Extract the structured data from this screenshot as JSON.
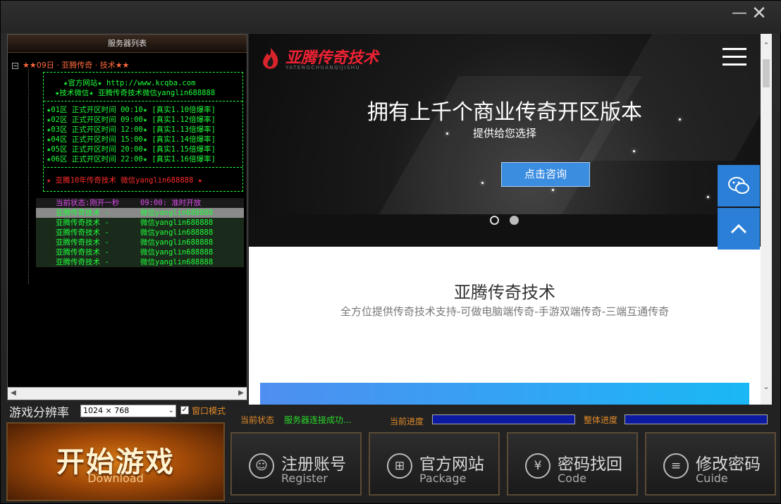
{
  "window": {
    "minimize_icon": "minimize-icon",
    "close_icon": "close-icon",
    "min_glyph": "—",
    "close_glyph": "✕"
  },
  "server_list": {
    "header": "服务器列表",
    "root": "★★09日 · 亚腾传奇 · 技术★★",
    "info": {
      "site": "★官方网站★ http://www.kcqba.com",
      "wechat": "★技术微信★ 亚腾传奇技术微信yanglin688888",
      "zones": [
        "★01区 正式开区时间  00:10★ [真实1.10倍爆率]",
        "★02区 正式开区时间  09:00★ [真实1.12倍爆率]",
        "★03区 正式开区时间  12:00★ [真实1.13倍爆率]",
        "★04区 正式开区时间  15:00★ [真实1.14倍爆率]",
        "★05区 正式开区时间  20:00★ [真实1.15倍爆率]",
        "★06区 正式开区时间  22:00★ [真实1.16倍爆率]"
      ],
      "footer": "★   亚腾10年传奇技术 微信yanglin688888   ★"
    },
    "status_header": {
      "col1": "当前状态:刚开一秒",
      "col2": "09:00: 准时开放"
    },
    "servers": [
      {
        "name": "亚腾传奇技术 -",
        "contact": "微信yanglin688888"
      },
      {
        "name": "亚腾传奇技术 -",
        "contact": "微信yanglin688888"
      },
      {
        "name": "亚腾传奇技术 -",
        "contact": "微信yanglin688888"
      },
      {
        "name": "亚腾传奇技术 -",
        "contact": "微信yanglin688888"
      },
      {
        "name": "亚腾传奇技术 -",
        "contact": "微信yanglin688888"
      },
      {
        "name": "亚腾传奇技术 -",
        "contact": "微信yanglin688888"
      }
    ],
    "selected_index": 0
  },
  "resolution": {
    "label": "游戏分辨率",
    "value": "1024 × 768",
    "window_mode_label": "窗口模式",
    "window_mode_checked": true,
    "check_glyph": "✓",
    "dropdown_glyph": "⌄"
  },
  "web": {
    "logo_text": "亚腾传奇技术",
    "logo_sub": "YATENGCHUANQIJISHU",
    "hero_title": "拥有上千个商业传奇开区版本",
    "hero_subtitle": "提供给您选择",
    "hero_button": "点击咨询",
    "section_title": "亚腾传奇技术",
    "section_subtitle": "全方位提供传奇技术支持-可做电脑端传奇-手游双端传奇-三端互通传奇",
    "slide_count": 2,
    "active_slide": 2
  },
  "status": {
    "current_label": "当前状态",
    "current_value": "服务器连接成功...",
    "progress_label": "当前进度",
    "progress_fraction": 1.0,
    "total_label": "整体进度",
    "total_fraction": 1.0,
    "progress_color": "#0b1aa0"
  },
  "buttons": {
    "start": {
      "zh": "开始游戏",
      "en": "Download"
    },
    "register": {
      "zh": "注册账号",
      "en": "Register",
      "icon": "user-icon",
      "glyph": "☺"
    },
    "website": {
      "zh": "官方网站",
      "en": "Package",
      "icon": "gift-icon",
      "glyph": "⊞"
    },
    "recover": {
      "zh": "密码找回",
      "en": "Code",
      "icon": "yen-icon",
      "glyph": "¥"
    },
    "change": {
      "zh": "修改密码",
      "en": "Cuide",
      "icon": "document-icon",
      "glyph": "≡"
    }
  },
  "colors": {
    "accent_orange": "#e08a2a",
    "list_green": "#1eff3b",
    "brand_blue": "#2b7fd6"
  }
}
